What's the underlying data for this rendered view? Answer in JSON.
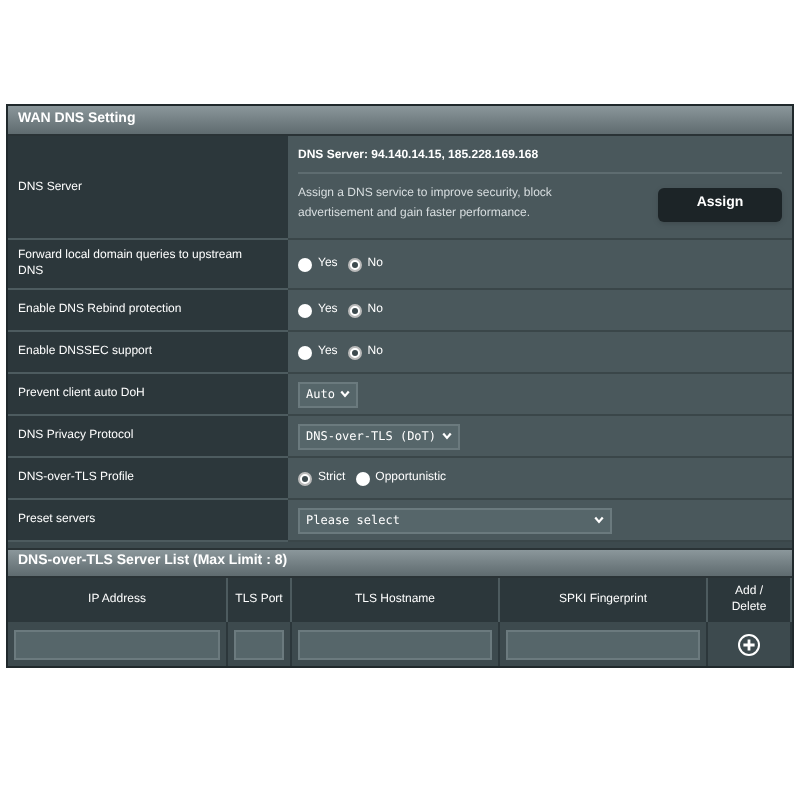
{
  "section_title": "WAN DNS Setting",
  "settings": [
    {
      "kind": "dns",
      "label": "DNS Server",
      "server": "DNS Server: 94.140.14.15, 185.228.169.168",
      "description": "Assign a DNS service to improve security, block advertisement and gain faster performance.",
      "button": "Assign"
    },
    {
      "kind": "radio",
      "label": "Forward local domain queries to upstream DNS",
      "options": [
        {
          "label": "Yes",
          "selected": false
        },
        {
          "label": "No",
          "selected": true
        }
      ]
    },
    {
      "kind": "radio",
      "label": "Enable DNS Rebind protection",
      "options": [
        {
          "label": "Yes",
          "selected": false
        },
        {
          "label": "No",
          "selected": true
        }
      ]
    },
    {
      "kind": "radio",
      "label": "Enable DNSSEC support",
      "options": [
        {
          "label": "Yes",
          "selected": false
        },
        {
          "label": "No",
          "selected": true
        }
      ]
    },
    {
      "kind": "select",
      "label": "Prevent client auto DoH",
      "value": "Auto"
    },
    {
      "kind": "select",
      "label": "DNS Privacy Protocol",
      "value": "DNS-over-TLS (DoT)"
    },
    {
      "kind": "radio",
      "label": "DNS-over-TLS Profile",
      "options": [
        {
          "label": "Strict",
          "selected": true
        },
        {
          "label": "Opportunistic",
          "selected": false
        }
      ]
    },
    {
      "kind": "select",
      "label": "Preset servers",
      "value": "Please select",
      "wide": true
    }
  ],
  "server_list": {
    "title": "DNS-over-TLS Server List (Max Limit : 8)",
    "columns": [
      "IP Address",
      "TLS Port",
      "TLS Hostname",
      "SPKI Fingerprint",
      "Add / Delete"
    ]
  }
}
